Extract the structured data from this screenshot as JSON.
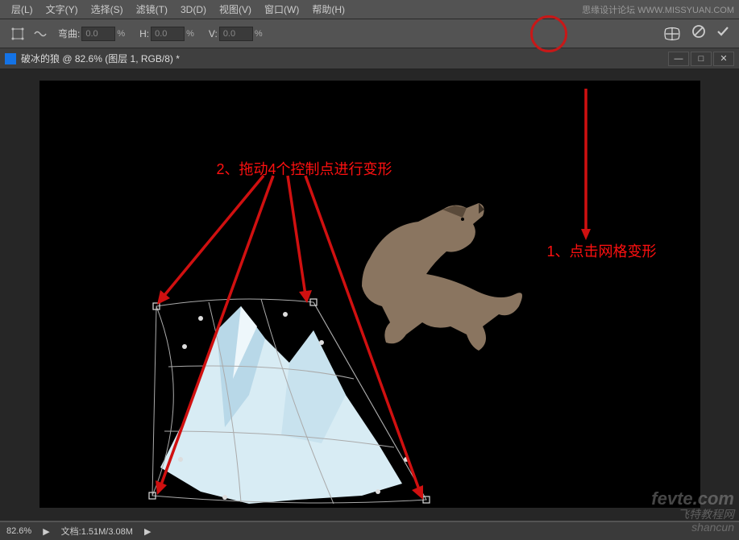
{
  "menubar": {
    "items": [
      "层(L)",
      "文字(Y)",
      "选择(S)",
      "滤镜(T)",
      "3D(D)",
      "视图(V)",
      "窗口(W)",
      "帮助(H)"
    ],
    "branding": "思缘设计论坛  WWW.MISSYUAN.COM"
  },
  "optionsbar": {
    "bend_label": "弯曲:",
    "bend_value": "0.0",
    "h_label": "H:",
    "h_value": "0.0",
    "v_label": "V:",
    "v_value": "0.0",
    "pct": "%"
  },
  "document": {
    "title": "破冰的狼 @ 82.6% (图层 1, RGB/8) *"
  },
  "annotations": {
    "step1": "1、点击网格变形",
    "step2": "2、拖动4个控制点进行变形"
  },
  "statusbar": {
    "zoom": "82.6%",
    "doc": "文档:1.51M/3.08M"
  },
  "watermark": {
    "line1": "fevte.com",
    "line2": "飞特教程网",
    "line3": "shancun"
  }
}
